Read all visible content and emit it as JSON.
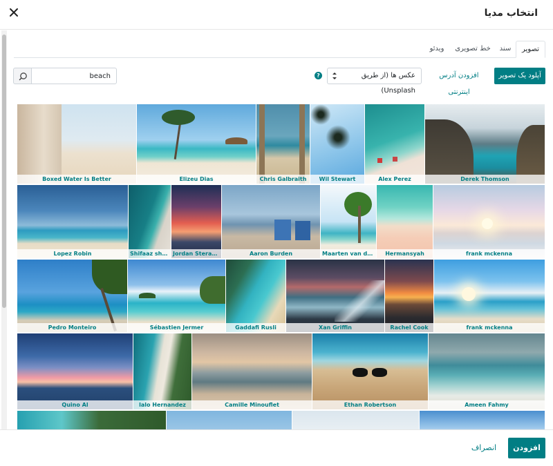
{
  "header": {
    "title": "انتخاب مدیا"
  },
  "tabs": [
    {
      "label": "تصویر",
      "active": true
    },
    {
      "label": "سند",
      "active": false
    },
    {
      "label": "خط تصویری",
      "active": false
    },
    {
      "label": "ویدئو",
      "active": false
    }
  ],
  "toolbar": {
    "upload_label": "آپلود یک تصویر",
    "add_url_label": "افزودن آدرس اینترنتی",
    "source_selected": "عکس ها (از طریق Unsplash)",
    "help_glyph": "?"
  },
  "search": {
    "value": "beach",
    "placeholder": ""
  },
  "images": [
    {
      "caption": "Boxed Water Is Better"
    },
    {
      "caption": "Elizeu Dias"
    },
    {
      "caption": "Chris Galbraith"
    },
    {
      "caption": "Wil Stewart"
    },
    {
      "caption": "Alex Perez"
    },
    {
      "caption": "Derek Thomson"
    },
    {
      "caption": "Lopez Robin"
    },
    {
      "caption": "Shifaaz sham..."
    },
    {
      "caption": "Jordan Steranka"
    },
    {
      "caption": "Aaron Burden"
    },
    {
      "caption": "Maarten van den H..."
    },
    {
      "caption": "Hermansyah"
    },
    {
      "caption": "frank mckenna"
    },
    {
      "caption": "Pedro Monteiro"
    },
    {
      "caption": "Sébastien Jermer"
    },
    {
      "caption": "Gaddafi Rusli"
    },
    {
      "caption": "Xan Griffin"
    },
    {
      "caption": "Rachel Cook"
    },
    {
      "caption": "frank mckenna"
    },
    {
      "caption": "Quino Al"
    },
    {
      "caption": "lalo Hernandez"
    },
    {
      "caption": "Camille Minouflet"
    },
    {
      "caption": "Ethan Robertson"
    },
    {
      "caption": "Ameen Fahmy"
    },
    {
      "caption": ""
    },
    {
      "caption": ""
    },
    {
      "caption": ""
    },
    {
      "caption": ""
    }
  ],
  "footer": {
    "add_label": "افزودن",
    "cancel_label": "انصراف"
  },
  "colors": {
    "accent": "#017e84"
  }
}
